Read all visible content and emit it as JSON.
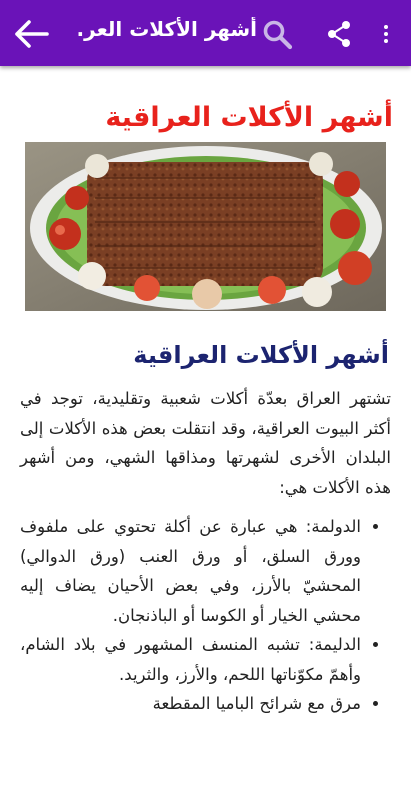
{
  "appbar": {
    "title": "أشهر الأكلات العر...",
    "back_icon": "arrow-left-icon",
    "search_icon": "search-icon",
    "share_icon": "share-icon",
    "more_icon": "more-vert-icon",
    "color": "#6a13b8"
  },
  "article": {
    "main_title": "أشهر الأكلات العراقية",
    "main_title_color": "#e8221c",
    "image_alt": "kebab-dish-photo",
    "section_title": "أشهر الأكلات العراقية",
    "section_title_color": "#1c2470",
    "intro": "تشتهر العراق بعدّة أكلات شعبية وتقليدية، توجد في أكثر البيوت العراقية، وقد انتقلت بعض هذه الأكلات إلى البلدان الأخرى لشهرتها ومذاقها الشهي، ومن أشهر هذه الأكلات هي:",
    "items": [
      "الدولمة: هي عبارة عن أكلة تحتوي على ملفوف وورق السلق، أو ورق العنب (ورق الدوالي) المحشيّ بالأرز، وفي بعض الأحيان يضاف إليه محشي الخيار أو الكوسا أو الباذنجان.",
      "الدليمة: تشبه المنسف المشهور في بلاد الشام، وأهمّ مكوّناتها اللحم، والأرز، والثريد.",
      "مرق مع شرائح الباميا المقطعة"
    ]
  }
}
